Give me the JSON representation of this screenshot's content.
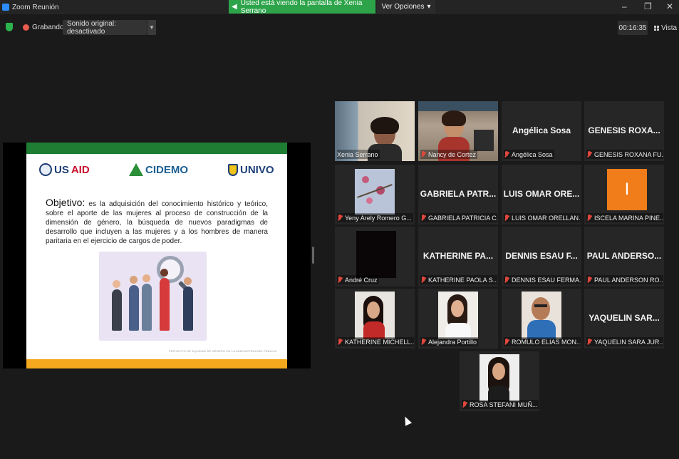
{
  "window": {
    "title": "Zoom Reunión",
    "share_banner": "Usted está viendo la pantalla de Xenia Serrano",
    "view_options": "Ver Opciones",
    "minimize": "–",
    "maximize": "❐",
    "close": "✕"
  },
  "toolbar": {
    "recording_label": "Grabando",
    "original_sound": "Sonido original: desactivado",
    "timer": "00:16:35",
    "view_label": "Vista"
  },
  "slide": {
    "logo_usaid_a": "US",
    "logo_usaid_b": "AID",
    "logo_cidemo": "CIDEMO",
    "logo_univo": "UNIVO",
    "objective_title": "Objetivo:",
    "objective_body": " es la adquisición del conocimiento histórico y teórico, sobre el aporte de las mujeres  al proceso de construcción de la dimensión de género, la búsqueda de nuevos paradigmas de desarrollo que incluyen a las mujeres y a los hombres de manera paritaria en el ejercicio de cargos de poder.",
    "footer": "PROYECTO DE EQUIDAD DE GÉNERO EN LA ADMINISTRACIÓN PÚBLICA"
  },
  "participants": [
    {
      "label": "Xenia Serrano",
      "big": "",
      "video": "xenia",
      "active": true
    },
    {
      "label": "Nancy de Cortez",
      "big": "",
      "video": "nancy"
    },
    {
      "label": "Angélica Sosa",
      "big": "Angélica Sosa"
    },
    {
      "label": "GENESIS ROXANA FU...",
      "big": "GENESIS ROXA..."
    },
    {
      "label": "Yeny Arely Romero G...",
      "big": "",
      "video": "yeny"
    },
    {
      "label": "GABRIELA PATRICIA C...",
      "big": "GABRIELA PATR..."
    },
    {
      "label": "LUIS OMAR ORELLAN...",
      "big": "LUIS OMAR ORE..."
    },
    {
      "label": "ISCELA MARINA PINE...",
      "big": "",
      "video": "iscela",
      "initial": "I"
    },
    {
      "label": "André Cruz",
      "big": "",
      "video": "andre"
    },
    {
      "label": "KATHERINE PAOLA S...",
      "big": "KATHERINE PA..."
    },
    {
      "label": "DENNIS ESAU FERMA...",
      "big": "DENNIS ESAU F..."
    },
    {
      "label": "PAUL ANDERSON RO...",
      "big": "PAUL ANDERSO..."
    },
    {
      "label": "KATHERINE MICHELL...",
      "big": "",
      "video": "kmichell"
    },
    {
      "label": "Alejandra Portillo",
      "big": "",
      "video": "alejandra"
    },
    {
      "label": "ROMULO ELIAS MON...",
      "big": "",
      "video": "romulo"
    },
    {
      "label": "YAQUELIN SARA JUR...",
      "big": "YAQUELIN SAR..."
    },
    {
      "label": "ROSA STEFANI MUÑ...",
      "big": "",
      "video": "rosa"
    }
  ],
  "colors": {
    "banner_green": "#2da44a",
    "active_speaker": "#e8e35a",
    "mic_muted": "#e0483d",
    "slide_green": "#1e7d33",
    "slide_orange": "#f4a81d",
    "iscela_avatar": "#f07d1a"
  },
  "icons": {
    "security": "shield-icon",
    "recording": "record-dot-icon",
    "view": "grid-view-icon",
    "muted": "mic-muted-icon"
  }
}
